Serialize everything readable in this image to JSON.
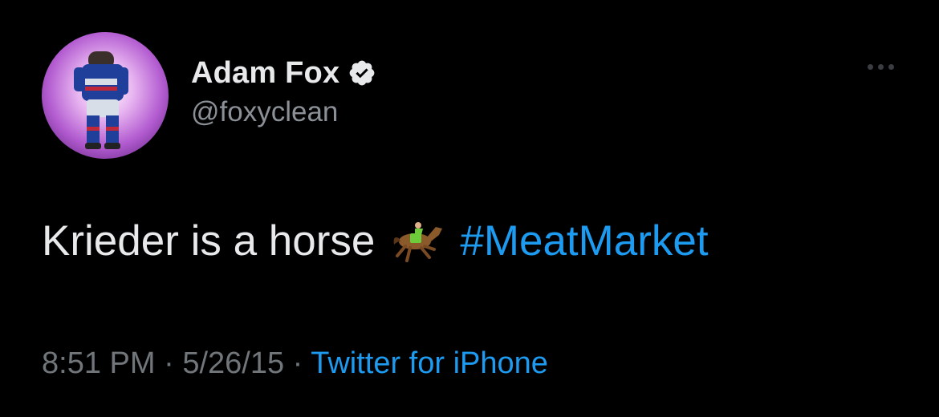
{
  "tweet": {
    "display_name": "Adam Fox",
    "handle": "@foxyclean",
    "text": "Krieder is a horse",
    "emoji": "horse-racing-emoji",
    "hashtag": "#MeatMarket",
    "time": "8:51 PM",
    "separator": "·",
    "date": "5/26/15",
    "source": "Twitter for iPhone"
  },
  "icons": {
    "verified": "verified-badge-icon",
    "more": "more-options-icon"
  },
  "colors": {
    "background": "#000000",
    "primary_text": "#e7e9ea",
    "secondary_text": "#71767b",
    "link": "#1d9bf0"
  }
}
